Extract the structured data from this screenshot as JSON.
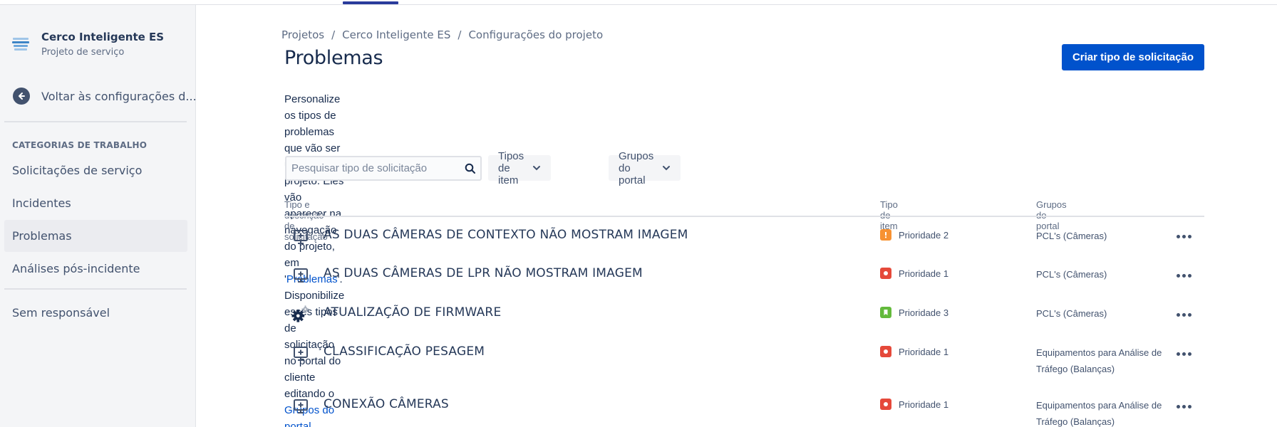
{
  "project": {
    "name": "Cerco Inteligente ES",
    "type": "Projeto de serviço",
    "logo": "project-logo"
  },
  "sidebar": {
    "back_label": "Voltar às configurações d...",
    "section_title": "CATEGORIAS DE TRABALHO",
    "items": [
      {
        "label": "Solicitações de serviço",
        "active": false
      },
      {
        "label": "Incidentes",
        "active": false
      },
      {
        "label": "Problemas",
        "active": true
      },
      {
        "label": "Análises pós-incidente",
        "active": false
      }
    ],
    "extra_item": "Sem responsável"
  },
  "breadcrumb": [
    "Projetos",
    "Cerco Inteligente ES",
    "Configurações do projeto"
  ],
  "page_title": "Problemas",
  "create_button": "Criar tipo de solicitação",
  "description": {
    "line1_prefix": "Personalize os tipos de problemas que vão ser usados no projeto. Eles vão aparecer na navegação do projeto, em '",
    "line1_link": "Problemas",
    "line1_suffix": "'.",
    "line2_prefix": "Disponibilize esses tipos de solicitação no portal do cliente editando o ",
    "line2_link": "Grupos do portal"
  },
  "search": {
    "placeholder": "Pesquisar tipo de solicitação",
    "value": ""
  },
  "filters": [
    "Tipos de item",
    "Grupos do portal"
  ],
  "table": {
    "headers": [
      "Tipo e descrição de solicitação",
      "Tipo de item",
      "Grupos do portal"
    ],
    "rows": [
      {
        "icon": "monitor-plus-icon",
        "name": "AS DUAS CÂMERAS DE CONTEXTO NÃO MOSTRAM IMAGEM",
        "priority": "Prioridade 2",
        "priority_icon": "exclamation-icon",
        "priority_color": "#f79232",
        "portal": "PCL's (Câmeras)"
      },
      {
        "icon": "monitor-plus-icon",
        "name": "AS DUAS CÂMERAS DE LPR NÃO MOSTRAM IMAGEM",
        "priority": "Prioridade 1",
        "priority_icon": "dot-icon",
        "priority_color": "#e5493a",
        "portal": "PCL's (Câmeras)"
      },
      {
        "icon": "gears-icon",
        "name": "ATUALIZAÇÃO DE FIRMWARE",
        "priority": "Prioridade 3",
        "priority_icon": "bookmark-icon",
        "priority_color": "#63ba3c",
        "portal": "PCL's (Câmeras)"
      },
      {
        "icon": "monitor-plus-icon",
        "name": "CLASSIFICAÇÃO PESAGEM",
        "priority": "Prioridade 1",
        "priority_icon": "dot-icon",
        "priority_color": "#e5493a",
        "portal": "Equipamentos para Análise de Tráfego (Balanças)"
      },
      {
        "icon": "monitor-plus-icon",
        "name": "CONEXÃO CÂMERAS",
        "priority": "Prioridade 1",
        "priority_icon": "dot-icon",
        "priority_color": "#e5493a",
        "portal": "Equipamentos para Análise de Tráfego (Balanças)"
      }
    ]
  },
  "colors": {
    "primary": "#0052cc",
    "sidebar_bg": "#f4f5f7",
    "text": "#172b4d",
    "muted": "#5e6c84"
  }
}
